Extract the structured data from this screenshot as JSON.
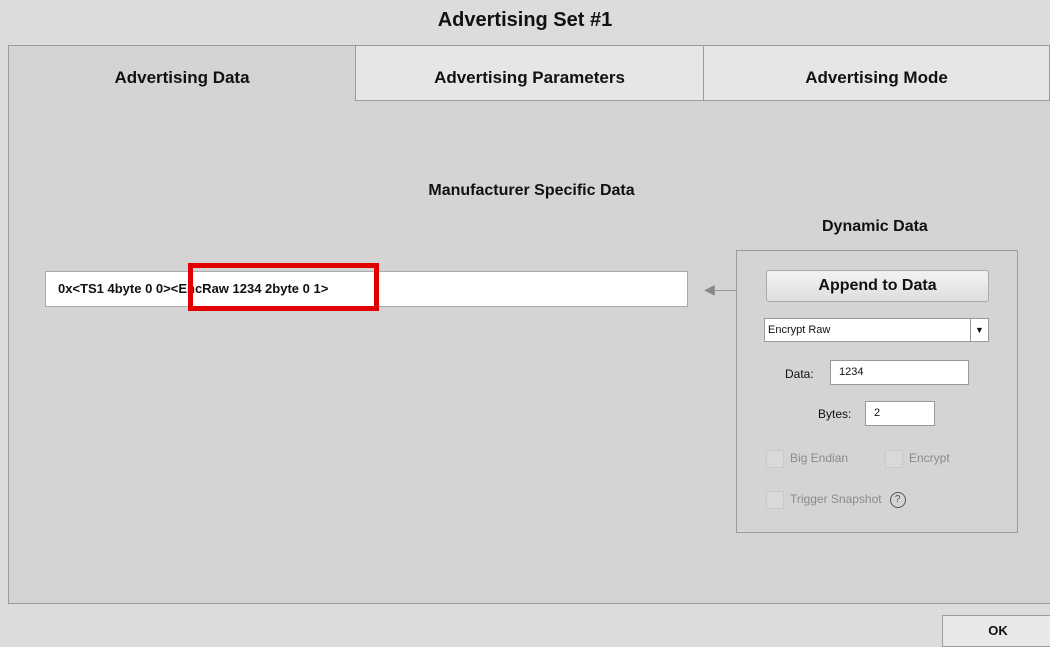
{
  "window": {
    "title": "Advertising Set #1"
  },
  "tabs": [
    {
      "label": "Advertising Data",
      "active": true
    },
    {
      "label": "Advertising Parameters",
      "active": false
    },
    {
      "label": "Advertising Mode",
      "active": false
    }
  ],
  "manufacturer": {
    "heading": "Manufacturer Specific Data",
    "value_part1": "0x<TS1 4byte 0 0>",
    "value_part2": "<EncRaw 1234 2byte 0 1>"
  },
  "highlight": {
    "color": "#e00000"
  },
  "dynamic": {
    "heading": "Dynamic Data",
    "append_label": "Append to Data",
    "type_selected": "Encrypt Raw",
    "data_label": "Data:",
    "data_value": "1234",
    "bytes_label": "Bytes:",
    "bytes_value": "2",
    "big_endian_label": "Big Endian",
    "encrypt_label": "Encrypt",
    "trigger_label": "Trigger Snapshot",
    "help_glyph": "?"
  },
  "footer": {
    "ok_label": "OK"
  },
  "icons": {
    "arrow": "arrow-left-icon",
    "dropdown": "chevron-down-icon",
    "help": "help-icon"
  }
}
